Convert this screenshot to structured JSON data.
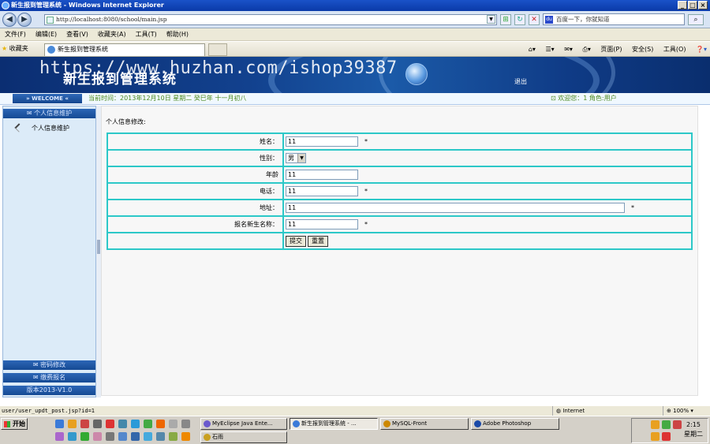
{
  "window": {
    "title": "新生报到管理系统 - Windows Internet Explorer"
  },
  "address": {
    "url": "http://localhost:8080/school/main.jsp",
    "search_placeholder": "百度一下，你就知道"
  },
  "menu": {
    "items": [
      "文件(F)",
      "编辑(E)",
      "查看(V)",
      "收藏夹(A)",
      "工具(T)",
      "帮助(H)"
    ]
  },
  "favbar": {
    "favorites": "收藏夹",
    "tab_title": "新生报到管理系统",
    "commands": [
      "页面(P)",
      "安全(S)",
      "工具(O)"
    ]
  },
  "banner": {
    "site_title": "新生报到管理系统",
    "watermark": "https://www.huzhan.com/ishop39387",
    "logout": "退出"
  },
  "infobar": {
    "welcome": "» WELCOME «",
    "date": "当前时间：2013年12月10日 星期二 癸巳年 十一月初八",
    "user": "欢迎您：1 角色:用户"
  },
  "sidebar": {
    "header": "个人信息维护",
    "item": "个人信息维护",
    "bottom": [
      "密码修改",
      "缴费报名",
      "版本2013-V1.0"
    ]
  },
  "form": {
    "title": "个人信息修改:",
    "rows": [
      {
        "label": "姓名：",
        "value": "11",
        "required": "*"
      },
      {
        "label": "性别：",
        "value": "男"
      },
      {
        "label": "年龄",
        "value": "11"
      },
      {
        "label": "电话：",
        "value": "11",
        "required": "*"
      },
      {
        "label": "地址：",
        "value": "11",
        "required": "*"
      },
      {
        "label": "报名新生名称：",
        "value": "11",
        "required": "*"
      }
    ],
    "submit": "提交",
    "reset": "重置"
  },
  "statusbar": {
    "text": "user/user_updt_post.jsp?id=1",
    "zone": "Internet",
    "zoom": "100%"
  },
  "taskbar": {
    "start": "开始",
    "tasks": [
      "MyEclipse Java Ente...",
      "新生报到管理系统 - ...",
      "MySQL-Front",
      "Adobe Photoshop",
      "石雨"
    ],
    "time": "2:15",
    "day": "星期二"
  },
  "colors": {
    "banner": "#12418e",
    "table_border": "#2cc8c8",
    "info_green": "#4c8a1e"
  }
}
